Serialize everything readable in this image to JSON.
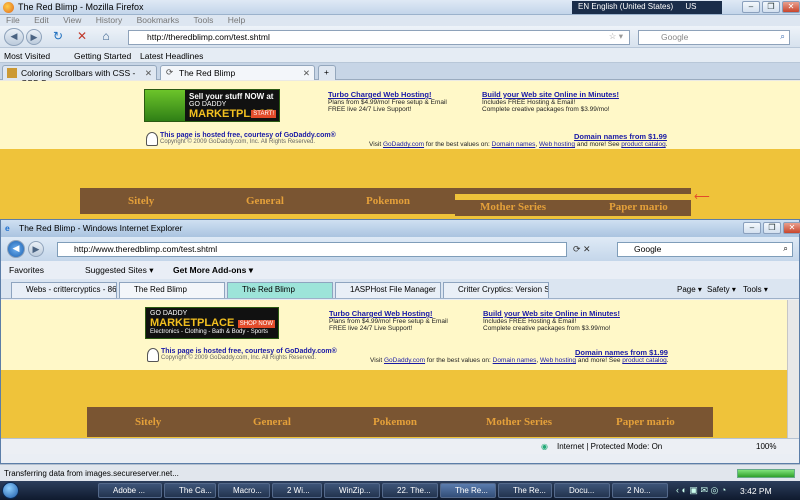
{
  "firefox": {
    "title": "The Red Blimp - Mozilla Firefox",
    "lang": "EN English (United States)",
    "lang_region": "US",
    "menu": [
      "File",
      "Edit",
      "View",
      "History",
      "Bookmarks",
      "Tools",
      "Help"
    ],
    "url": "http://theredblimp.com/test.shtml",
    "search_placeholder": "Google",
    "bookmarks": [
      "Most Visited",
      "Getting Started",
      "Latest Headlines"
    ],
    "tabs": [
      "Coloring Scrollbars with CSS - CSS S...",
      "The Red Blimp"
    ],
    "status": "Transferring data from images.secureserver.net...",
    "progress": 1.0
  },
  "godaddy": {
    "ad1_line1": "Sell your stuff NOW at",
    "ad1_line2": "GO DADDY",
    "ad1_line3": "MARKETPLACE",
    "ad1_button": "START!",
    "ad2_line1": "GO DADDY",
    "ad2_line2": "MARKETPLACE",
    "ad2_button": "SHOP NOW",
    "ad2_line3": "Electronics - Clothing - Bath & Body - Sports",
    "promo1_title": "Turbo Charged Web Hosting!",
    "promo1_l1": "Plans from $4.99/mo! Free setup & Email",
    "promo1_l2": "FREE live 24/7 Live Support!",
    "promo2_title": "Build your Web site Online in Minutes!",
    "promo2_l1": "Includes FREE Hosting & Email!",
    "promo2_l2": "Complete creative packages from $3.99/mo!",
    "hosted": "This page is hosted free, courtesy of GoDaddy.com®",
    "copyright": "Copyright © 2009 GoDaddy.com, Inc. All Rights Reserved.",
    "domain_names": "Domain names from $1.99",
    "visit_prefix": "Visit",
    "visit_godaddy": "GoDaddy.com",
    "visit_mid": "for the best values on:",
    "visit_domain": "Domain names",
    "visit_comma": ",",
    "visit_webhosting": "Web hosting",
    "visit_and": "and more! See",
    "visit_catalog": "product catalog",
    "visit_dot": "."
  },
  "nav": [
    "Sitely",
    "General",
    "Pokemon",
    "Mother Series",
    "Paper mario"
  ],
  "ie": {
    "title": "The Red Blimp - Windows Internet Explorer",
    "url": "http://www.theredblimp.com/test.shtml",
    "search": "Google",
    "favorites": "Favorites",
    "suggested": "Suggested Sites ▾",
    "addons": "Get More Add-ons ▾",
    "tabs": [
      "Webs - crittercryptics - 86a",
      "The Red Blimp",
      "The Red Blimp",
      "1ASPHost File Manager",
      "Critter Cryptics: Version S..."
    ],
    "cmd": [
      "Page ▾",
      "Safety ▾",
      "Tools ▾"
    ],
    "status_zone": "Internet | Protected Mode: On",
    "zoom": "100%"
  },
  "taskbar": {
    "items": [
      "Adobe ...",
      "The Ca...",
      "Macro...",
      "2 Wi...",
      "WinZip...",
      "22. The...",
      "The Re...",
      "The Re...",
      "Docu...",
      "2 No..."
    ],
    "clock": "3:42 PM"
  },
  "colors": {
    "page_bg": "#efc33a",
    "banner_bg": "#fff8c8",
    "nav_band": "#7a5532",
    "nav_text": "#e4a03a",
    "link": "#1a1aa6"
  }
}
